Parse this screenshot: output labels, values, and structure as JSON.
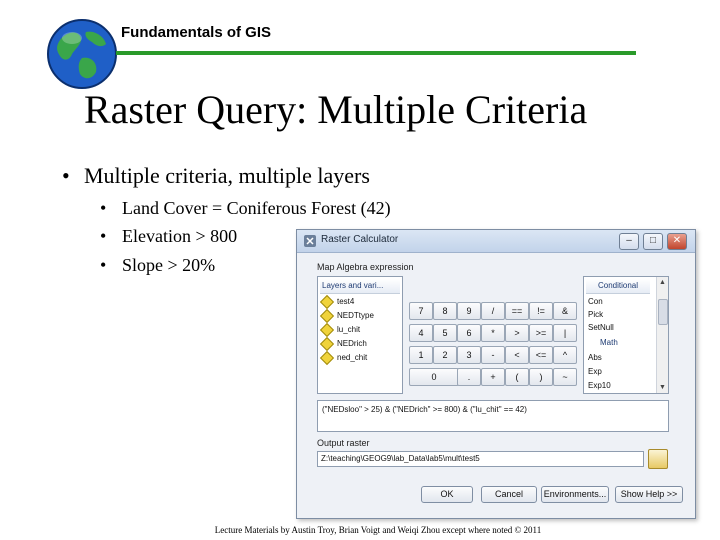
{
  "header": {
    "course_title": "Fundamentals of GIS"
  },
  "slide": {
    "title": "Raster Query: Multiple Criteria",
    "bullet_main": "Multiple criteria, multiple layers",
    "sub_bullets": [
      "Land Cover = Coniferous Forest (42)",
      "Elevation > 800",
      "Slope > 20%"
    ]
  },
  "dialog": {
    "title": "Raster Calculator",
    "minimize": "–",
    "maximize": "□",
    "close": "✕",
    "map_algebra_label": "Map Algebra expression",
    "layers_header": "Layers and vari...",
    "layers": [
      "test4",
      "NEDTtype",
      "lu_chit",
      "NEDrich",
      "ned_chit"
    ],
    "keypad": [
      [
        "7",
        "8",
        "9",
        "/",
        "==",
        "!=",
        "&"
      ],
      [
        "4",
        "5",
        "6",
        "*",
        ">",
        ">=",
        "|"
      ],
      [
        "1",
        "2",
        "3",
        "-",
        "<",
        "<=",
        "^"
      ],
      [
        "0",
        ".",
        "+",
        "(",
        ")",
        "~"
      ]
    ],
    "functions_header": "Conditional",
    "functions": [
      "Con",
      "Pick",
      "SetNull",
      "Math",
      "Abs",
      "Exp",
      "Exp10"
    ],
    "expression": "(\"NEDsloo\" > 25) & (\"NEDrich\" >= 800) & (\"lu_chit\" == 42)",
    "output_label": "Output raster",
    "output_path": "Z:\\teaching\\GEOG9\\lab_Data\\lab5\\mult\\test5",
    "buttons": {
      "ok": "OK",
      "cancel": "Cancel",
      "environments": "Environments...",
      "show_help": "Show Help >>"
    }
  },
  "footer": "Lecture Materials by Austin Troy, Brian Voigt and Weiqi Zhou except where noted © 2011"
}
